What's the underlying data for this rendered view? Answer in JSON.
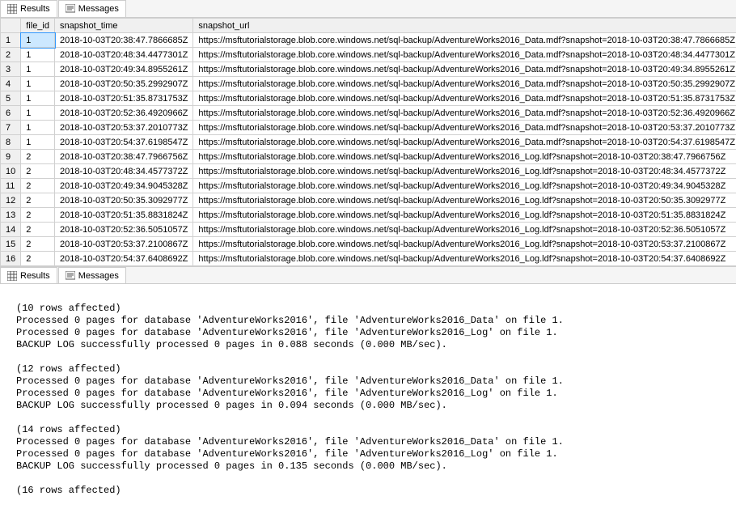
{
  "tabs_top": {
    "results": "Results",
    "messages": "Messages"
  },
  "tabs_bottom": {
    "results": "Results",
    "messages": "Messages"
  },
  "columns": {
    "file_id": "file_id",
    "snapshot_time": "snapshot_time",
    "snapshot_url": "snapshot_url"
  },
  "rows": [
    {
      "n": "1",
      "file_id": "1",
      "snapshot_time": "2018-10-03T20:38:47.7866685Z",
      "snapshot_url": "https://msftutorialstorage.blob.core.windows.net/sql-backup/AdventureWorks2016_Data.mdf?snapshot=2018-10-03T20:38:47.7866685Z"
    },
    {
      "n": "2",
      "file_id": "1",
      "snapshot_time": "2018-10-03T20:48:34.4477301Z",
      "snapshot_url": "https://msftutorialstorage.blob.core.windows.net/sql-backup/AdventureWorks2016_Data.mdf?snapshot=2018-10-03T20:48:34.4477301Z"
    },
    {
      "n": "3",
      "file_id": "1",
      "snapshot_time": "2018-10-03T20:49:34.8955261Z",
      "snapshot_url": "https://msftutorialstorage.blob.core.windows.net/sql-backup/AdventureWorks2016_Data.mdf?snapshot=2018-10-03T20:49:34.8955261Z"
    },
    {
      "n": "4",
      "file_id": "1",
      "snapshot_time": "2018-10-03T20:50:35.2992907Z",
      "snapshot_url": "https://msftutorialstorage.blob.core.windows.net/sql-backup/AdventureWorks2016_Data.mdf?snapshot=2018-10-03T20:50:35.2992907Z"
    },
    {
      "n": "5",
      "file_id": "1",
      "snapshot_time": "2018-10-03T20:51:35.8731753Z",
      "snapshot_url": "https://msftutorialstorage.blob.core.windows.net/sql-backup/AdventureWorks2016_Data.mdf?snapshot=2018-10-03T20:51:35.8731753Z"
    },
    {
      "n": "6",
      "file_id": "1",
      "snapshot_time": "2018-10-03T20:52:36.4920966Z",
      "snapshot_url": "https://msftutorialstorage.blob.core.windows.net/sql-backup/AdventureWorks2016_Data.mdf?snapshot=2018-10-03T20:52:36.4920966Z"
    },
    {
      "n": "7",
      "file_id": "1",
      "snapshot_time": "2018-10-03T20:53:37.2010773Z",
      "snapshot_url": "https://msftutorialstorage.blob.core.windows.net/sql-backup/AdventureWorks2016_Data.mdf?snapshot=2018-10-03T20:53:37.2010773Z"
    },
    {
      "n": "8",
      "file_id": "1",
      "snapshot_time": "2018-10-03T20:54:37.6198547Z",
      "snapshot_url": "https://msftutorialstorage.blob.core.windows.net/sql-backup/AdventureWorks2016_Data.mdf?snapshot=2018-10-03T20:54:37.6198547Z"
    },
    {
      "n": "9",
      "file_id": "2",
      "snapshot_time": "2018-10-03T20:38:47.7966756Z",
      "snapshot_url": "https://msftutorialstorage.blob.core.windows.net/sql-backup/AdventureWorks2016_Log.ldf?snapshot=2018-10-03T20:38:47.7966756Z"
    },
    {
      "n": "10",
      "file_id": "2",
      "snapshot_time": "2018-10-03T20:48:34.4577372Z",
      "snapshot_url": "https://msftutorialstorage.blob.core.windows.net/sql-backup/AdventureWorks2016_Log.ldf?snapshot=2018-10-03T20:48:34.4577372Z"
    },
    {
      "n": "11",
      "file_id": "2",
      "snapshot_time": "2018-10-03T20:49:34.9045328Z",
      "snapshot_url": "https://msftutorialstorage.blob.core.windows.net/sql-backup/AdventureWorks2016_Log.ldf?snapshot=2018-10-03T20:49:34.9045328Z"
    },
    {
      "n": "12",
      "file_id": "2",
      "snapshot_time": "2018-10-03T20:50:35.3092977Z",
      "snapshot_url": "https://msftutorialstorage.blob.core.windows.net/sql-backup/AdventureWorks2016_Log.ldf?snapshot=2018-10-03T20:50:35.3092977Z"
    },
    {
      "n": "13",
      "file_id": "2",
      "snapshot_time": "2018-10-03T20:51:35.8831824Z",
      "snapshot_url": "https://msftutorialstorage.blob.core.windows.net/sql-backup/AdventureWorks2016_Log.ldf?snapshot=2018-10-03T20:51:35.8831824Z"
    },
    {
      "n": "14",
      "file_id": "2",
      "snapshot_time": "2018-10-03T20:52:36.5051057Z",
      "snapshot_url": "https://msftutorialstorage.blob.core.windows.net/sql-backup/AdventureWorks2016_Log.ldf?snapshot=2018-10-03T20:52:36.5051057Z"
    },
    {
      "n": "15",
      "file_id": "2",
      "snapshot_time": "2018-10-03T20:53:37.2100867Z",
      "snapshot_url": "https://msftutorialstorage.blob.core.windows.net/sql-backup/AdventureWorks2016_Log.ldf?snapshot=2018-10-03T20:53:37.2100867Z"
    },
    {
      "n": "16",
      "file_id": "2",
      "snapshot_time": "2018-10-03T20:54:37.6408692Z",
      "snapshot_url": "https://msftutorialstorage.blob.core.windows.net/sql-backup/AdventureWorks2016_Log.ldf?snapshot=2018-10-03T20:54:37.6408692Z"
    }
  ],
  "messages": [
    "",
    "(10 rows affected)",
    "Processed 0 pages for database 'AdventureWorks2016', file 'AdventureWorks2016_Data' on file 1.",
    "Processed 0 pages for database 'AdventureWorks2016', file 'AdventureWorks2016_Log' on file 1.",
    "BACKUP LOG successfully processed 0 pages in 0.088 seconds (0.000 MB/sec).",
    "",
    "(12 rows affected)",
    "Processed 0 pages for database 'AdventureWorks2016', file 'AdventureWorks2016_Data' on file 1.",
    "Processed 0 pages for database 'AdventureWorks2016', file 'AdventureWorks2016_Log' on file 1.",
    "BACKUP LOG successfully processed 0 pages in 0.094 seconds (0.000 MB/sec).",
    "",
    "(14 rows affected)",
    "Processed 0 pages for database 'AdventureWorks2016', file 'AdventureWorks2016_Data' on file 1.",
    "Processed 0 pages for database 'AdventureWorks2016', file 'AdventureWorks2016_Log' on file 1.",
    "BACKUP LOG successfully processed 0 pages in 0.135 seconds (0.000 MB/sec).",
    "",
    "(16 rows affected)"
  ]
}
